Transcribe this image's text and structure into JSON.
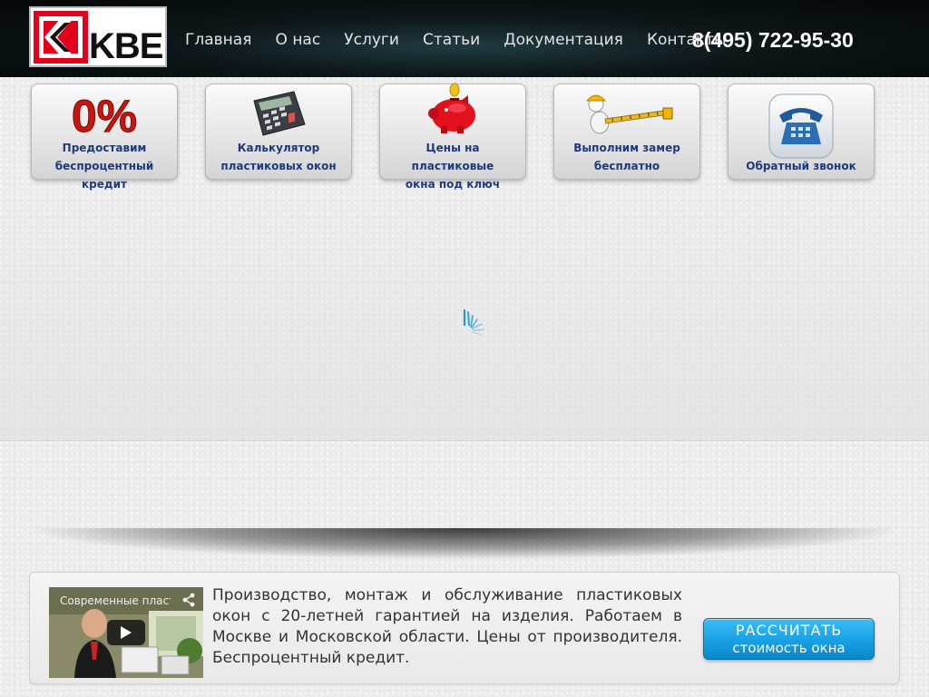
{
  "header": {
    "logo_text": "KBE",
    "nav": [
      {
        "label": "Главная"
      },
      {
        "label": "О нас"
      },
      {
        "label": "Услуги"
      },
      {
        "label": "Статьи"
      },
      {
        "label": "Документация"
      },
      {
        "label": "Контакты"
      }
    ],
    "phone": "8(495) 722-95-30"
  },
  "tiles": [
    {
      "icon": "percent-icon",
      "big_text": "0%",
      "line1": "Предоставим",
      "line2": "беспроцентный кредит"
    },
    {
      "icon": "calculator-icon",
      "line1": "Калькулятор",
      "line2": "пластиковых окон"
    },
    {
      "icon": "piggy-bank-icon",
      "line1": "Цены на пластиковые",
      "line2": "окна под ключ"
    },
    {
      "icon": "measuring-tape-icon",
      "line1": "Выполним замер",
      "line2": "бесплатно"
    },
    {
      "icon": "telephone-icon",
      "line1": "",
      "line2": "Обратный звонок"
    }
  ],
  "slider": {
    "loading": true,
    "spinner_icon": "loading-spinner-icon"
  },
  "info": {
    "video_title": "Современные пласт",
    "text": "Производство, монтаж и обслуживание пластиковых окон с 20-летней гарантией на изделия. Работаем в Москве и Московской области. Цены от производителя. Беспроцентный кредит.",
    "cta_line1": "РАССЧИТАТЬ",
    "cta_line2": "стоимость окна"
  },
  "colors": {
    "header_bg": "#0d1618",
    "tile_text": "#1e3a78",
    "cta": "#1aa3e6",
    "logo_red": "#e3001b"
  }
}
